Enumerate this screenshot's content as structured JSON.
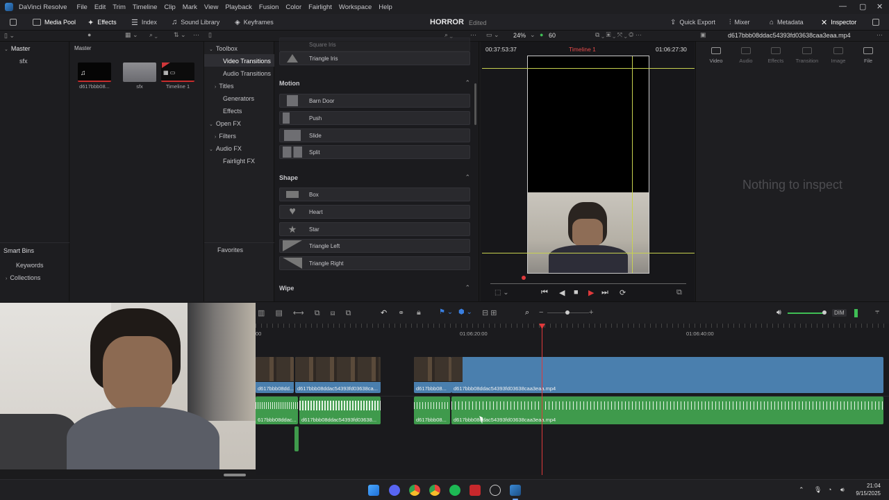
{
  "app": {
    "name": "DaVinci Resolve",
    "menu": [
      "File",
      "Edit",
      "Trim",
      "Timeline",
      "Clip",
      "Mark",
      "View",
      "Playback",
      "Fusion",
      "Color",
      "Fairlight",
      "Workspace",
      "Help"
    ],
    "window_controls": [
      "—",
      "▢",
      "✕"
    ]
  },
  "toolbar": {
    "media_pool": "Media Pool",
    "effects": "Effects",
    "index": "Index",
    "sound_library": "Sound Library",
    "keyframes": "Keyframes",
    "project_name": "HORROR",
    "project_status": "Edited",
    "quick_export": "Quick Export",
    "mixer": "Mixer",
    "metadata": "Metadata",
    "inspector": "Inspector"
  },
  "viewer_bar": {
    "zoom": "24%",
    "fps": "60",
    "clip_name": "d617bbb08ddac54393fd03638caa3eaa.mp4"
  },
  "bins": {
    "master": "Master",
    "sfx": "sfx",
    "smart_bins": "Smart Bins",
    "keywords": "Keywords",
    "collections": "Collections"
  },
  "media_pool": {
    "header": "Master",
    "items": [
      {
        "label": "d617bbb08..."
      },
      {
        "label": "sfx"
      },
      {
        "label": "Timeline 1"
      }
    ]
  },
  "toolbox": {
    "items": [
      {
        "label": "Toolbox",
        "arrow": "⌄"
      },
      {
        "label": "Video Transitions",
        "arrow": ""
      },
      {
        "label": "Audio Transitions",
        "arrow": ""
      },
      {
        "label": "Titles",
        "arrow": "›"
      },
      {
        "label": "Generators",
        "arrow": ""
      },
      {
        "label": "Effects",
        "arrow": ""
      },
      {
        "label": "Open FX",
        "arrow": "⌄"
      },
      {
        "label": "Filters",
        "arrow": "›"
      },
      {
        "label": "Audio FX",
        "arrow": "⌄"
      },
      {
        "label": "Fairlight FX",
        "arrow": ""
      }
    ],
    "favorites": "Favorites"
  },
  "effects": {
    "partial_top": "Square Iris",
    "triangle_iris": "Triangle Iris",
    "motion_header": "Motion",
    "motion": [
      "Barn Door",
      "Push",
      "Slide",
      "Split"
    ],
    "shape_header": "Shape",
    "shape": [
      "Box",
      "Heart",
      "Star",
      "Triangle Left",
      "Triangle Right"
    ],
    "wipe_header": "Wipe"
  },
  "viewer": {
    "timecode_left": "00:37:53:37",
    "timeline_name": "Timeline 1",
    "timecode_right": "01:06:27:30"
  },
  "inspector": {
    "tabs": [
      "Video",
      "Audio",
      "Effects",
      "Transition",
      "Image",
      "File"
    ],
    "empty_text": "Nothing to inspect"
  },
  "timeline": {
    "ruler": [
      "00",
      "01:06:20:00",
      "01:06:40:00"
    ],
    "audio_level_label": "DIM",
    "video_clips": [
      {
        "label": "d617bbb08dd..."
      },
      {
        "label": "d617bbb08ddac54393fd03638ca..."
      },
      {
        "label": "d617bbb08..."
      },
      {
        "label": "d617bbb08ddac54393fd03638caa3eaa.mp4"
      }
    ],
    "audio_clips": [
      {
        "label": "617bbb08ddac..."
      },
      {
        "label": "d617bbb08ddac54393fd03638..."
      },
      {
        "label": "d617bbb08..."
      },
      {
        "label": "d617bbb08ddac54393fd03638caa3eaa.mp4"
      }
    ]
  },
  "taskbar": {
    "time": "21:04",
    "date": "9/15/2025"
  },
  "colors": {
    "playhead": "#e0393b",
    "video_clip": "#4a7fae",
    "audio_clip": "#3f9a4c",
    "accent": "#e64c4c"
  }
}
